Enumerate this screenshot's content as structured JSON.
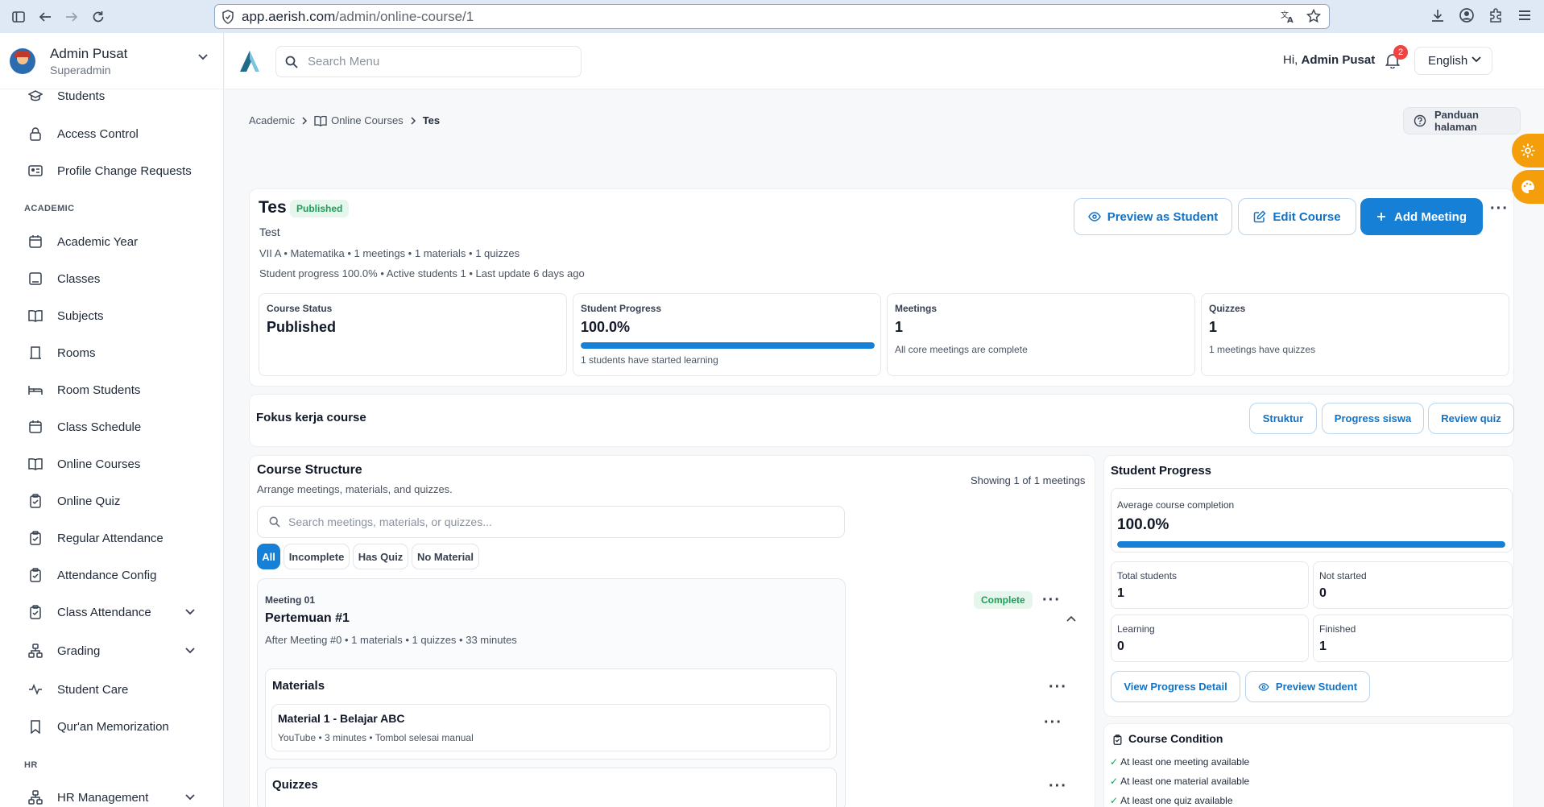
{
  "browser": {
    "url_host": "app.aerish.com",
    "url_path": "/admin/online-course/1"
  },
  "sidebar": {
    "profile": {
      "name": "Admin Pusat",
      "role": "Superadmin"
    },
    "items_top": [
      {
        "label": "Students",
        "icon": "graduation-cap-icon"
      },
      {
        "label": "Access Control",
        "icon": "lock-icon"
      },
      {
        "label": "Profile Change Requests",
        "icon": "id-card-icon"
      }
    ],
    "section_academic": "ACADEMIC",
    "items_academic": [
      {
        "label": "Academic Year",
        "icon": "calendar-icon"
      },
      {
        "label": "Classes",
        "icon": "tablet-icon"
      },
      {
        "label": "Subjects",
        "icon": "book-open-icon"
      },
      {
        "label": "Rooms",
        "icon": "door-icon"
      },
      {
        "label": "Room Students",
        "icon": "bed-icon"
      },
      {
        "label": "Class Schedule",
        "icon": "calendar-icon"
      },
      {
        "label": "Online Courses",
        "icon": "book-open-icon"
      },
      {
        "label": "Online Quiz",
        "icon": "clipboard-icon"
      },
      {
        "label": "Regular Attendance",
        "icon": "clipboard-check-icon"
      },
      {
        "label": "Attendance Config",
        "icon": "clipboard-icon"
      },
      {
        "label": "Class Attendance",
        "icon": "clipboard-icon"
      },
      {
        "label": "Grading",
        "icon": "network-icon"
      },
      {
        "label": "Student Care",
        "icon": "pulse-icon"
      },
      {
        "label": "Qur'an Memorization",
        "icon": "bookmark-icon"
      }
    ],
    "section_hr": "HR",
    "items_hr": [
      {
        "label": "HR Management",
        "icon": "network-icon"
      }
    ]
  },
  "topbar": {
    "search_placeholder": "Search Menu",
    "greeting_prefix": "Hi,",
    "greeting_name": "Admin Pusat",
    "notification_count": "2",
    "language": "English"
  },
  "breadcrumb": {
    "items": [
      "Academic",
      "Online Courses",
      "Tes"
    ]
  },
  "guide_button": "Panduan halaman",
  "course": {
    "title": "Tes",
    "status_badge": "Published",
    "subtitle": "Test",
    "meta_line": "VII A • Matematika • 1 meetings • 1 materials • 1 quizzes",
    "progress_line": "Student progress 100.0% • Active students 1 • Last update 6 days ago",
    "actions": {
      "preview": "Preview as Student",
      "edit": "Edit Course",
      "add": "Add Meeting"
    },
    "stats": [
      {
        "label": "Course Status",
        "value": "Published",
        "note": ""
      },
      {
        "label": "Student Progress",
        "value": "100.0%",
        "note": "1 students have started learning",
        "progress": 1.0
      },
      {
        "label": "Meetings",
        "value": "1",
        "note": "All core meetings are complete"
      },
      {
        "label": "Quizzes",
        "value": "1",
        "note": "1 meetings have quizzes"
      }
    ]
  },
  "focus": {
    "title": "Fokus kerja course",
    "buttons": [
      "Struktur",
      "Progress siswa",
      "Review quiz"
    ]
  },
  "structure": {
    "title": "Course Structure",
    "subtitle": "Arrange meetings, materials, and quizzes.",
    "showing": "Showing 1 of 1 meetings",
    "search_placeholder": "Search meetings, materials, or quizzes...",
    "filters": [
      "All",
      "Incomplete",
      "Has Quiz",
      "No Material"
    ],
    "meeting": {
      "label": "Meeting 01",
      "title": "Pertemuan #1",
      "meta": "After Meeting #0 • 1 materials • 1 quizzes • 33 minutes",
      "badge": "Complete",
      "materials_title": "Materials",
      "material": {
        "title": "Material 1 - Belajar ABC",
        "meta": "YouTube • 3 minutes • Tombol selesai manual"
      },
      "quizzes_title": "Quizzes"
    }
  },
  "student_progress": {
    "title": "Student Progress",
    "avg_label": "Average course completion",
    "avg_value": "100.0%",
    "avg_fraction": 1.0,
    "boxes": [
      {
        "label": "Total students",
        "value": "1"
      },
      {
        "label": "Not started",
        "value": "0"
      },
      {
        "label": "Learning",
        "value": "0"
      },
      {
        "label": "Finished",
        "value": "1"
      }
    ],
    "view_detail": "View Progress Detail",
    "preview_student": "Preview Student"
  },
  "condition": {
    "title": "Course Condition",
    "items": [
      "At least one meeting available",
      "At least one material available",
      "At least one quiz available"
    ]
  },
  "colors": {
    "accent": "#1580d6",
    "success": "#18a057",
    "badge": "#ef4444",
    "float_tab": "#f59e0b"
  }
}
